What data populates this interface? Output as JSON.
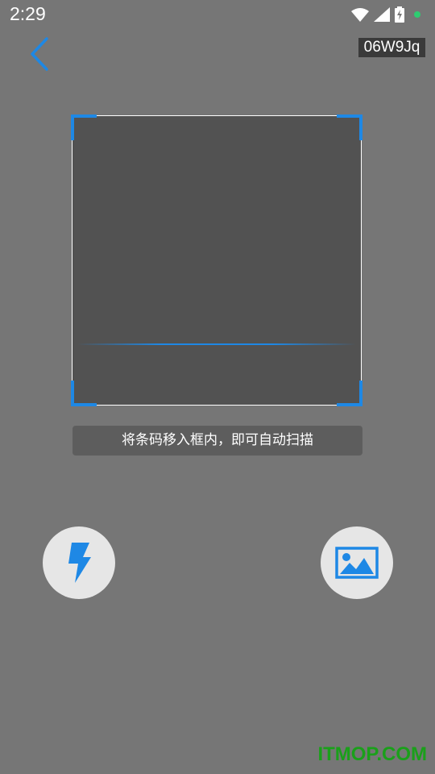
{
  "status_bar": {
    "time": "2:29",
    "icons": [
      "wifi-icon",
      "cell-signal-icon",
      "battery-charging-icon",
      "notification-dot"
    ]
  },
  "header": {
    "back_icon": "chevron-left-icon",
    "code_badge": "06W9Jq"
  },
  "scanner": {
    "hint_text": "将条码移入框内，即可自动扫描",
    "accent_color": "#1e88e5"
  },
  "actions": {
    "flashlight_icon": "lightning-icon",
    "gallery_icon": "image-icon"
  },
  "watermark": "ITMOP.COM"
}
